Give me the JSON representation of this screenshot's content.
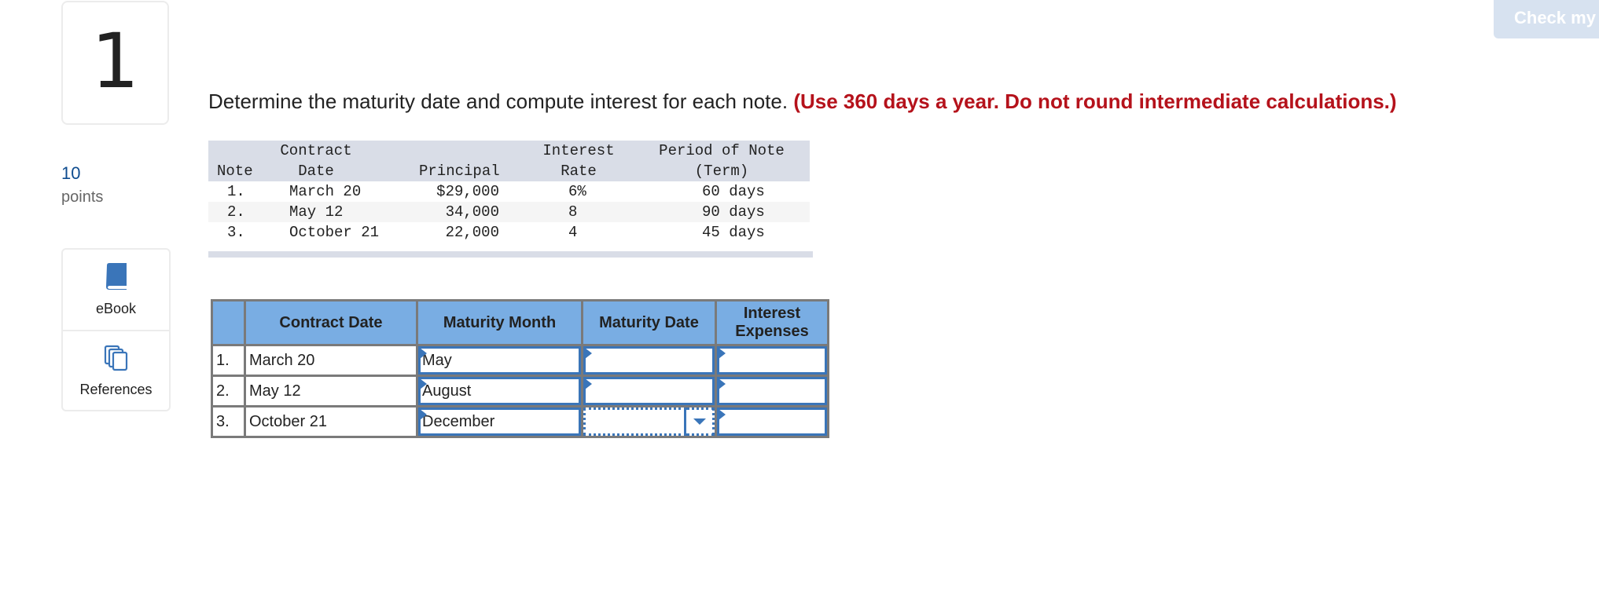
{
  "sidebar": {
    "question_number": "1",
    "points_value": "10",
    "points_label": "points",
    "tools": [
      {
        "label": "eBook",
        "icon": "book-icon"
      },
      {
        "label": "References",
        "icon": "references-icon"
      }
    ]
  },
  "header": {
    "check_button_label": "Check my"
  },
  "question": {
    "text": "Determine the maturity date and compute interest for each note.",
    "instruction": "(Use 360 days a year. Do not round intermediate calculations.)"
  },
  "given_table": {
    "headers": {
      "note": "Note",
      "contract_line1": "Contract",
      "contract_line2": "Date",
      "principal": "Principal",
      "rate_line1": "Interest",
      "rate_line2": "Rate",
      "term_line1": "Period of Note",
      "term_line2": "(Term)"
    },
    "rows": [
      {
        "note": "1.",
        "contract_date": "March 20",
        "principal": "$29,000",
        "rate": "6%",
        "term": "60 days"
      },
      {
        "note": "2.",
        "contract_date": "May 12",
        "principal": "34,000",
        "rate": "8",
        "term": "90 days"
      },
      {
        "note": "3.",
        "contract_date": "October 21",
        "principal": "22,000",
        "rate": "4",
        "term": "45 days"
      }
    ]
  },
  "answer_table": {
    "headers": {
      "num": "",
      "contract_date": "Contract Date",
      "maturity_month": "Maturity Month",
      "maturity_date": "Maturity Date",
      "interest_line1": "Interest",
      "interest_line2": "Expenses"
    },
    "rows": [
      {
        "num": "1.",
        "contract_date": "March 20",
        "maturity_month": "May",
        "maturity_date": "",
        "interest": ""
      },
      {
        "num": "2.",
        "contract_date": "May 12",
        "maturity_month": "August",
        "maturity_date": "",
        "interest": ""
      },
      {
        "num": "3.",
        "contract_date": "October 21",
        "maturity_month": "December",
        "maturity_date": "",
        "interest": ""
      }
    ]
  },
  "colors": {
    "accent": "#3a75b9",
    "header_blue": "#79ade3",
    "instruction_red": "#b5121b",
    "points_blue": "#0e4c8f"
  }
}
